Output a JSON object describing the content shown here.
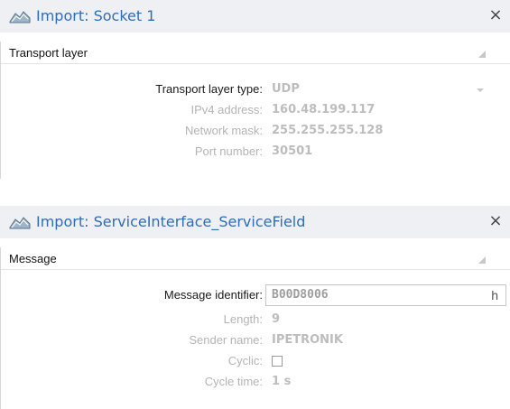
{
  "socket_panel": {
    "title": "Import: Socket 1",
    "close": "×",
    "section": "Transport layer",
    "fields": {
      "transport_type_label": "Transport layer type:",
      "transport_type_value": "UDP",
      "ipv4_label": "IPv4 address:",
      "ipv4_value": "160.48.199.117",
      "mask_label": "Network mask:",
      "mask_value": "255.255.255.128",
      "port_label": "Port number:",
      "port_value": "30501"
    }
  },
  "service_panel": {
    "title": "Import: ServiceInterface_ServiceField",
    "close": "×",
    "section": "Message",
    "fields": {
      "message_id_label": "Message identifier:",
      "message_id_value": "B00D8006",
      "message_id_suffix": "h",
      "length_label": "Length:",
      "length_value": "9",
      "sender_label": "Sender name:",
      "sender_value": "IPETRONIK",
      "cyclic_label": "Cyclic:",
      "cyclic_checked": false,
      "cycle_time_label": "Cycle time:",
      "cycle_time_value": "1 s"
    }
  },
  "colors": {
    "title_blue": "#2f6db5",
    "header_bg": "#eef0f3",
    "disabled_text": "#b4b4b4"
  },
  "icons": [
    "import-icon",
    "close-icon",
    "collapse-icon",
    "dropdown-arrow-icon"
  ]
}
